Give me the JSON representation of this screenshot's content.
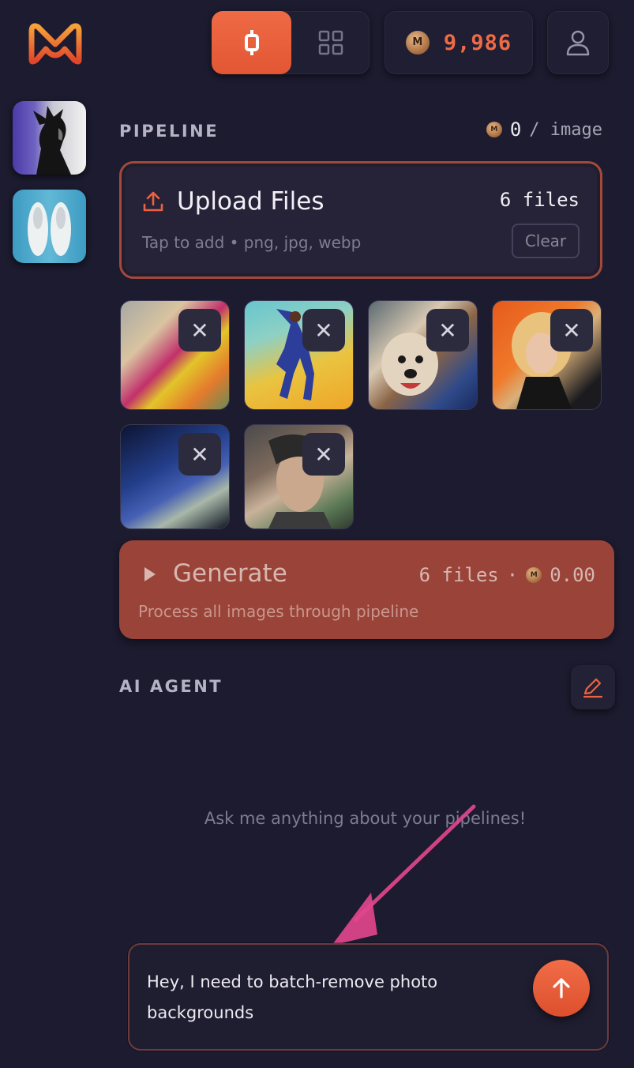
{
  "header": {
    "mode_tabs": [
      {
        "icon": "pipeline-icon",
        "active": true
      },
      {
        "icon": "grid-icon",
        "active": false
      }
    ],
    "credits": {
      "value": "9,986",
      "icon": "coin-icon"
    },
    "profile_icon": "user-icon"
  },
  "colors": {
    "accent": "#ec6240",
    "background": "#1c1b2f",
    "card": "#262338",
    "generate_bg": "#9a4338"
  },
  "sidebar": {
    "thumbnails": [
      {
        "name": "portrait-thumbnail"
      },
      {
        "name": "sneakers-thumbnail"
      }
    ]
  },
  "pipeline": {
    "label": "PIPELINE",
    "cost_value": "0",
    "cost_unit": "/ image"
  },
  "upload": {
    "title": "Upload Files",
    "count": "6 files",
    "hint": "Tap to add • png, jpg, webp",
    "clear_label": "Clear"
  },
  "files": [
    {
      "name": "fashion-pair"
    },
    {
      "name": "basketball-player"
    },
    {
      "name": "man-with-dog"
    },
    {
      "name": "woman-orange-bg"
    },
    {
      "name": "man-blue-suit"
    },
    {
      "name": "woman-braids"
    }
  ],
  "generate": {
    "title": "Generate",
    "files": "6 files",
    "separator": "·",
    "cost": "0.00",
    "subtitle": "Process all images through pipeline"
  },
  "agent": {
    "label": "AI AGENT",
    "empty_message": "Ask me anything about your pipelines!",
    "input_text": "Hey, I need to batch-remove photo backgrounds"
  }
}
